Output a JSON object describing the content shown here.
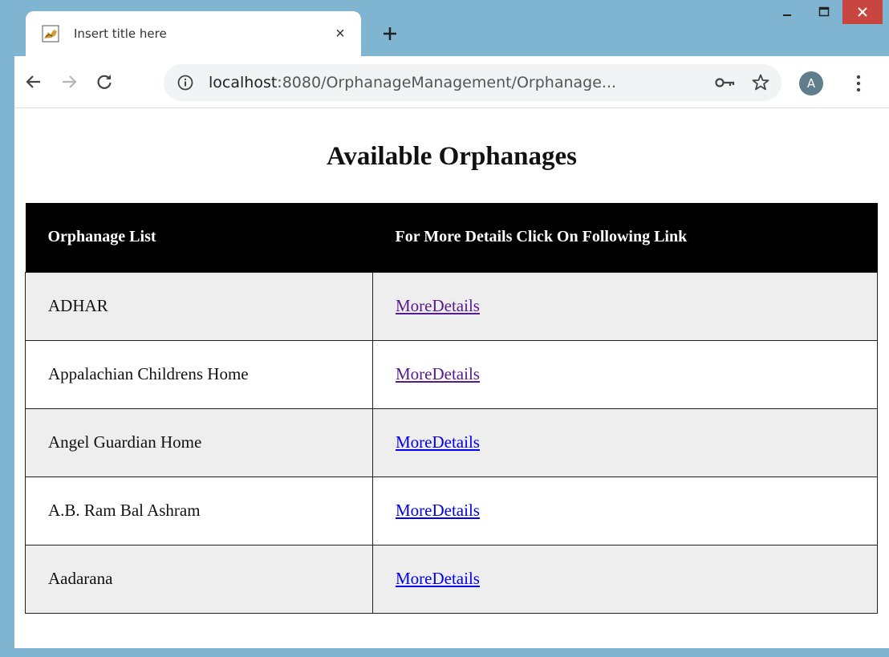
{
  "browser": {
    "tab_title": "Insert title here",
    "tab_close": "×",
    "url_host": "localhost",
    "url_rest": ":8080/OrphanageManagement/Orphanage...",
    "avatar_letter": "A"
  },
  "page": {
    "heading": "Available Orphanages",
    "table": {
      "columns": [
        "Orphanage List",
        "For More Details Click On Following Link"
      ],
      "rows": [
        {
          "name": "ADHAR",
          "link": "MoreDetails",
          "visited": true
        },
        {
          "name": "Appalachian Childrens Home",
          "link": "MoreDetails",
          "visited": true
        },
        {
          "name": "Angel Guardian Home",
          "link": "MoreDetails",
          "visited": false
        },
        {
          "name": "A.B. Ram Bal Ashram",
          "link": "MoreDetails",
          "visited": false
        },
        {
          "name": "Aadarana",
          "link": "MoreDetails",
          "visited": false
        }
      ]
    }
  },
  "colors": {
    "window_frame": "#7fb5d1",
    "close_button": "#c9453f",
    "header_bg": "#000000",
    "row_alt_bg": "#eeeeee",
    "link_visited": "#551a8b",
    "link_unvisited": "#0000ee",
    "avatar_bg": "#607d8b"
  },
  "icons": {
    "favicon": "tomcat-icon",
    "back": "arrow-left-icon",
    "forward": "arrow-right-icon",
    "reload": "reload-icon",
    "info": "info-icon",
    "key": "key-icon",
    "star": "star-icon",
    "menu": "kebab-menu-icon"
  }
}
